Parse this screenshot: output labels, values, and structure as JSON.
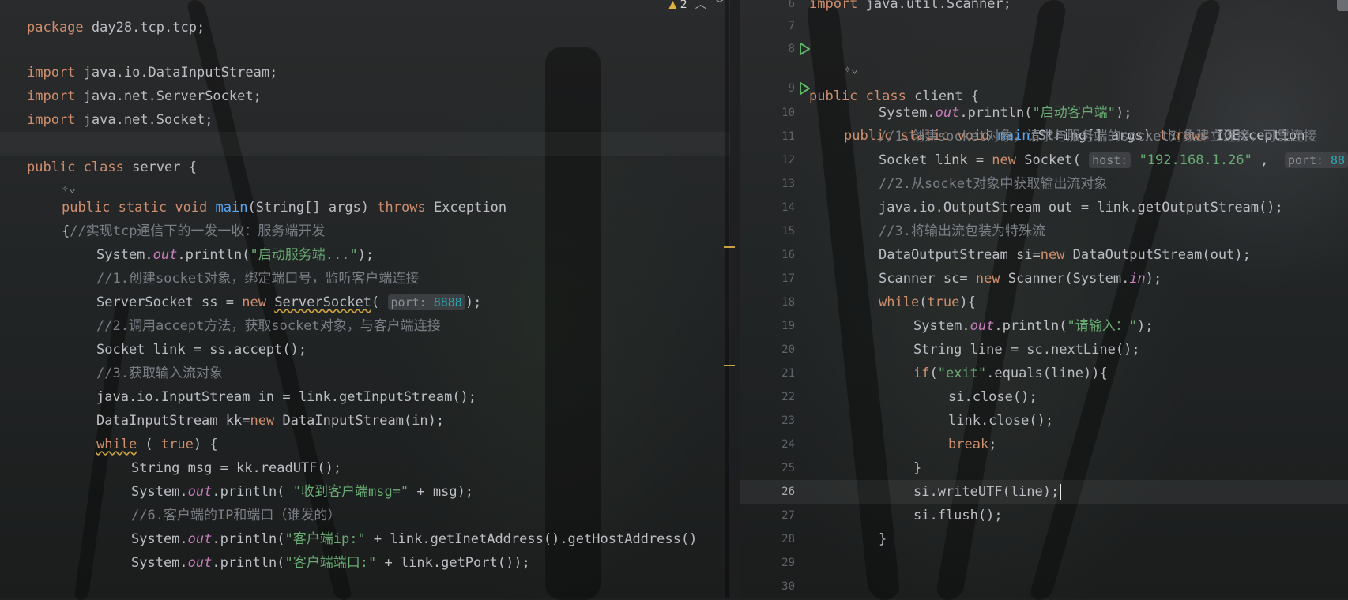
{
  "colors": {
    "keyword": "#cf8e6d",
    "string": "#6aab73",
    "number": "#2aacb8",
    "comment": "#7a7e85",
    "method": "#56a8f5",
    "static_field": "#c77dbb",
    "text": "#bcbec4",
    "warning": "#c9a042",
    "run_icon": "#5fb865"
  },
  "icons": {
    "run": "run-gutter-icon",
    "lens": "ai-lens-icon",
    "warning": "warning-triangle-icon"
  },
  "left_editor": {
    "warning_count": "2",
    "lines": {
      "package_kw": "package",
      "package_name": "day28.tcp.tcp;",
      "import_kw": "import",
      "import1": "java.io.DataInputStream;",
      "import2": "java.net.ServerSocket;",
      "import3": "java.net.Socket;",
      "class_public": "public",
      "class_kw": "class",
      "class_name": "server {",
      "lens": "✧⌄",
      "main_public": "public",
      "main_static": "static",
      "main_void": "void",
      "main_name": "main",
      "main_params": "(String[] args) ",
      "main_throws": "throws",
      "main_exc": "Exception",
      "brace_open": "{",
      "c1": "//实现tcp通信下的一发一收：服务端开发",
      "sys": "System.",
      "out": "out",
      "println_open": ".println(",
      "s1": "\"启动服务端...\"",
      "end_paren": ");",
      "c2": "//1.创建socket对象，绑定端口号，监听客户端连接",
      "ss_decl": "ServerSocket ss = ",
      "new": "new",
      "ss_ctor": "ServerSocket",
      "paren_open": "(",
      "port_hint": "port:",
      "port_num": "8888",
      "c3": "//2.调用accept方法，获取socket对象，与客户端连接",
      "accept": "Socket link = ss.accept();",
      "c4": "//3.获取输入流对象",
      "in_stream": "java.io.InputStream in = link.getInputStream();",
      "kk_decl": "DataInputStream kk=",
      "kk_ctor": "DataInputStream(in);",
      "while_kw": "while",
      "while_open": " ( ",
      "true_kw": "true",
      "while_close": ") {",
      "msg": "String msg = kk.readUTF();",
      "println_open_sp": ".println( ",
      "s2": "\"收到客户端msg=\"",
      "msg_concat": " + msg);",
      "c5": "//6.客户端的IP和端口（谁发的）",
      "s3": "\"客户端ip:\"",
      "ip_concat": " + link.getInetAddress().getHostAddress()",
      "s4": "\"客户端端口:\"",
      "port_concat": " + link.getPort());",
      "close_brace": "}"
    }
  },
  "right_editor": {
    "line_numbers": [
      "6",
      "7",
      "8",
      "9",
      "10",
      "11",
      "12",
      "13",
      "14",
      "15",
      "16",
      "17",
      "18",
      "19",
      "20",
      "21",
      "22",
      "23",
      "24",
      "25",
      "26",
      "27",
      "28",
      "29",
      "30"
    ],
    "current_line": "26",
    "lines": {
      "import_kw": "import",
      "import_scanner": "java.util.Scanner;",
      "class_public": "public",
      "class_kw": "class",
      "class_name": "client {",
      "lens": "✧⌄",
      "main_public": "public",
      "main_static": "static",
      "main_void": "void",
      "main_name": "main",
      "main_params": "(String[] args) ",
      "main_throws": "throws",
      "main_exc": "IOException",
      "sys": "System.",
      "out": "out",
      "println_open": ".println(",
      "s1": "\"启动客户端\"",
      "end_paren": ");",
      "c1": "//1.创建socket对象，请求与服务端的socket对象建立连接，可靠连接",
      "sock_decl": "Socket link = ",
      "new": "new",
      "sock_ctor": " Socket(",
      "host_hint": "host:",
      "host_val": "\"192.168.1.26\"",
      "comma": " , ",
      "port_hint": "port:",
      "port_num": "88",
      "c2": "//2.从socket对象中获取输出流对象",
      "out_stream": "java.io.OutputStream out = link.getOutputStream();",
      "c3": "//3.将输出流包装为特殊流",
      "si_decl": "DataOutputStream si=",
      "si_ctor": " DataOutputStream(out);",
      "sc_decl": "Scanner sc= ",
      "sc_ctor": " Scanner(System.",
      "in": "in",
      "while_kw": "while",
      "while_open": "(",
      "true_kw": "true",
      "while_close": "){",
      "s2": "\"请输入：\"",
      "line_decl": "String line = sc.nextLine();",
      "if_kw": "if",
      "if_open": "(",
      "s3": "\"exit\"",
      "if_rest": ".equals(line)){",
      "si_close": "si.close();",
      "link_close": "link.close();",
      "break_kw": "break",
      "semicolon": ";",
      "close_brace": "}",
      "write_utf": "si.writeUTF(line);",
      "flush": "si.flush();"
    }
  }
}
